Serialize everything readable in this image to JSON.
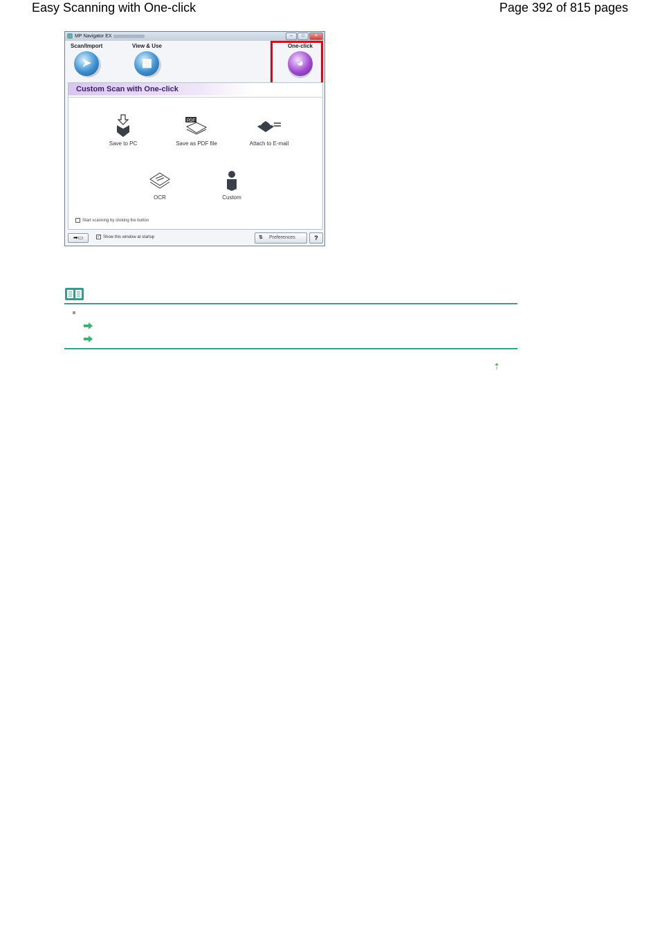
{
  "header": {
    "title": "Easy Scanning with One-click",
    "page_info": "Page 392 of 815 pages"
  },
  "window": {
    "app_title": "MP Navigator EX",
    "modes": {
      "scan_import": "Scan/Import",
      "view_use": "View & Use",
      "one_click": "One-click"
    },
    "panel_title": "Custom Scan with One-click",
    "actions": {
      "save_to_pc": "Save to PC",
      "save_as_pdf": "Save as PDF file",
      "attach_email": "Attach to E-mail",
      "ocr": "OCR",
      "custom": "Custom"
    },
    "pdf_badge": "PDF",
    "start_option": "Start scanning by clicking the button",
    "show_at_startup": "Show this window at startup",
    "preferences": "Preferences",
    "help": "?"
  },
  "colors": {
    "accent_teal": "#3a9a8e",
    "highlight_red": "#e8000e",
    "arrow_green": "#3cb371"
  }
}
